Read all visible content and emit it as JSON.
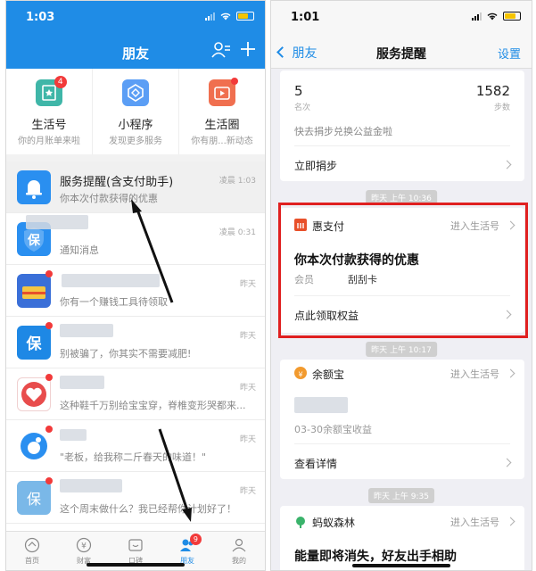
{
  "left": {
    "status_time": "1:03",
    "title": "朋友",
    "quick_actions": [
      {
        "label": "生活号",
        "sub": "你的月账单来啦",
        "badge": "4",
        "color": "#3fb6a8"
      },
      {
        "label": "小程序",
        "sub": "发现更多服务",
        "color": "#5b9ef5"
      },
      {
        "label": "生活圈",
        "sub": "你有朋...新动态",
        "color": "#f06f4f"
      }
    ],
    "messages": [
      {
        "name": "服务提醒(含支付助手)",
        "preview": "你本次付款获得的优惠",
        "time": "凌晨 1:03",
        "color": "#2a8ff0"
      },
      {
        "name": "",
        "preview": "通知消息",
        "time": "凌晨 0:31",
        "color": "#2a8ff0"
      },
      {
        "name": "",
        "preview": "你有一个赚钱工具待领取",
        "time": "昨天",
        "color": "#3a6fd8"
      },
      {
        "name": "",
        "preview": "别被骗了，你其实不需要减肥!",
        "time": "昨天",
        "color": "#1e88e5"
      },
      {
        "name": "",
        "preview": "这种鞋千万别给宝宝穿，脊椎变形哭都来...",
        "time": "昨天",
        "color": "#e84c4c"
      },
      {
        "name": "",
        "preview": "\"老板，给我称二斤春天的味道！\"",
        "time": "昨天",
        "color": "#2a8ff0"
      },
      {
        "name": "",
        "preview": "这个周末做什么？我已经帮你计划好了！",
        "time": "昨天",
        "color": "#7ab8e8"
      }
    ],
    "tabs": [
      {
        "label": "首页"
      },
      {
        "label": "财富"
      },
      {
        "label": "口碑"
      },
      {
        "label": "朋友",
        "badge": "9"
      },
      {
        "label": "我的"
      }
    ]
  },
  "right": {
    "status_time": "1:01",
    "back_label": "朋友",
    "title": "服务提醒",
    "settings_label": "设置",
    "card1": {
      "left_value": "5",
      "left_label": "名次",
      "right_value": "1582",
      "right_label": "步数",
      "text": "快去捐步兑换公益金啦",
      "action": "立即捐步"
    },
    "ts1": "昨天 上午 10:36",
    "card2": {
      "source": "惠支付",
      "goto": "进入生活号",
      "title": "你本次付款获得的优惠",
      "field_label": "会员",
      "field_value": "刮刮卡",
      "action": "点此领取权益",
      "brand_color": "#e8502a"
    },
    "ts2": "昨天 上午 10:17",
    "card3": {
      "source": "余额宝",
      "goto": "进入生活号",
      "text": "03-30余额宝收益",
      "action": "查看详情"
    },
    "ts3": "昨天 上午 9:35",
    "card4": {
      "source": "蚂蚁森林",
      "goto": "进入生活号",
      "title": "能量即将消失，好友出手相助"
    }
  },
  "colors": {
    "accent": "#1f8ce6",
    "highlight": "#e02020",
    "badge": "#f23a3a"
  }
}
